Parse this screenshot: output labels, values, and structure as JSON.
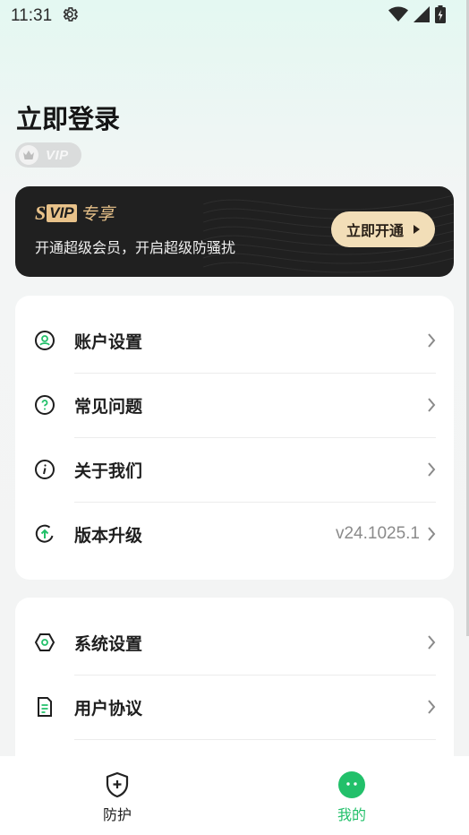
{
  "status_bar": {
    "time": "11:31",
    "icons": [
      "gear-icon",
      "wifi-icon",
      "signal-icon",
      "battery-charging-icon"
    ]
  },
  "profile": {
    "login_title": "立即登录",
    "vip_badge": "VIP"
  },
  "svip": {
    "title_s": "S",
    "title_vip": "VIP",
    "title_suffix": "专享",
    "description": "开通超级会员，开启超级防骚扰",
    "button_label": "立即开通"
  },
  "menu_group_1": [
    {
      "label": "账户设置",
      "icon": "user-circle-icon"
    },
    {
      "label": "常见问题",
      "icon": "question-circle-icon"
    },
    {
      "label": "关于我们",
      "icon": "info-circle-icon"
    },
    {
      "label": "版本升级",
      "icon": "upgrade-circle-icon",
      "value": "v24.1025.1"
    }
  ],
  "menu_group_2": [
    {
      "label": "系统设置",
      "icon": "hexagon-settings-icon"
    },
    {
      "label": "用户协议",
      "icon": "document-icon"
    }
  ],
  "tabbar": {
    "protect": "防护",
    "mine": "我的"
  },
  "colors": {
    "accent_green": "#22c06a",
    "gold": "#e8c28a",
    "card_dark": "#202020"
  }
}
